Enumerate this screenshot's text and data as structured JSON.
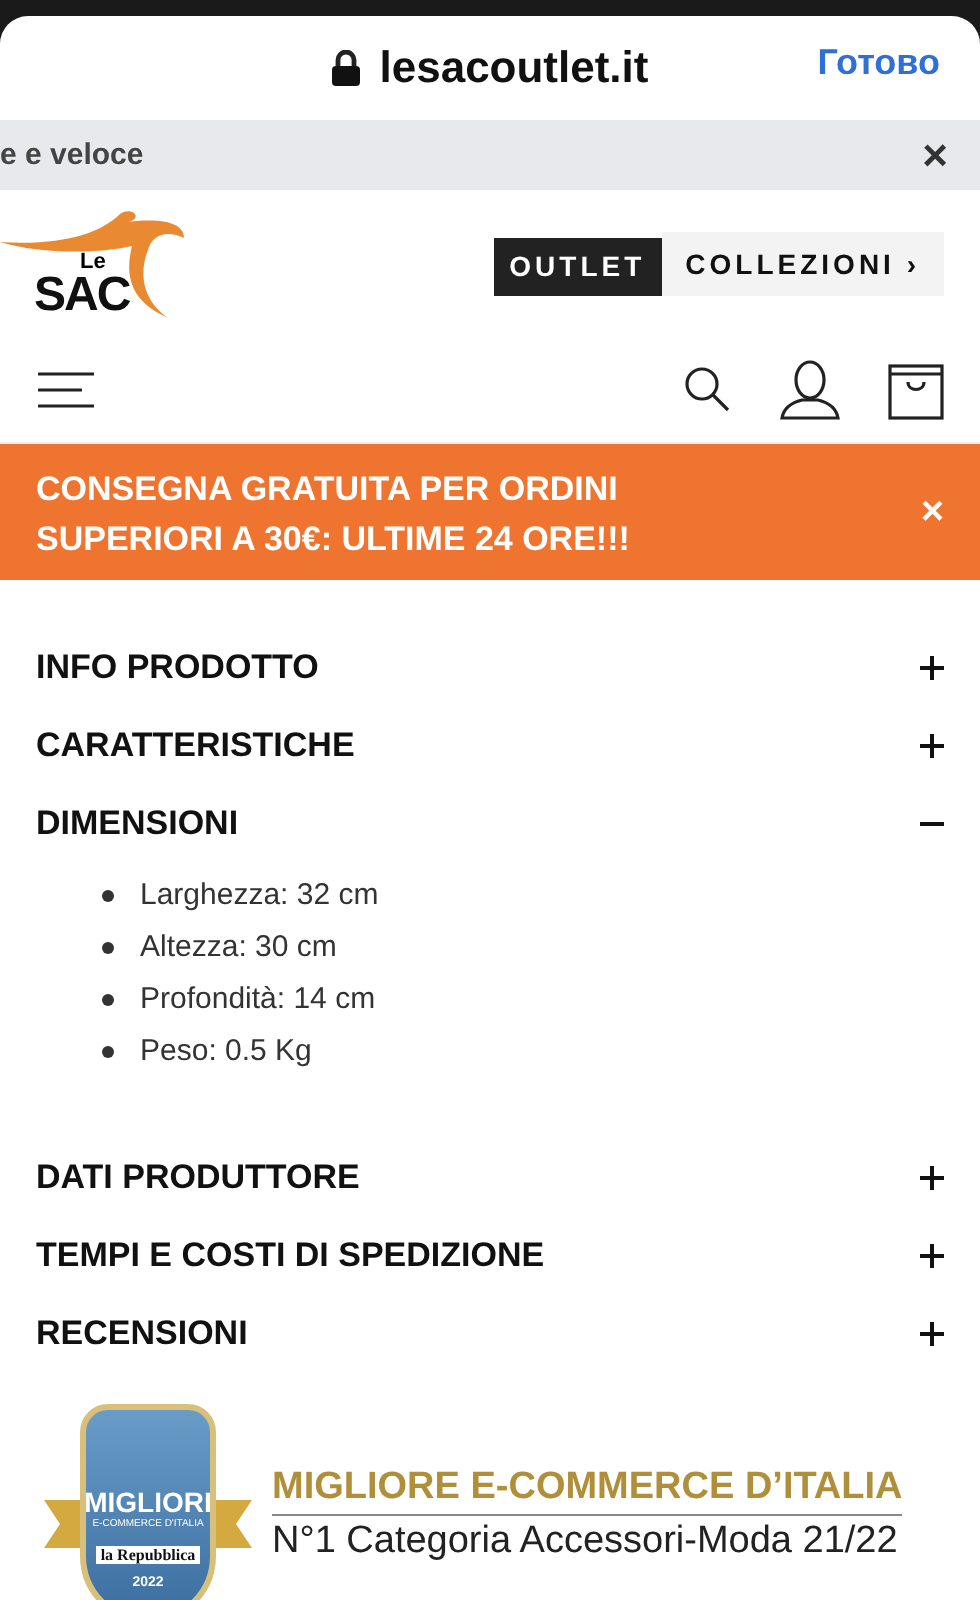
{
  "browser": {
    "domain": "lesacoutlet.it",
    "done": "Готово"
  },
  "notice": {
    "text": "e e veloce",
    "close": "×"
  },
  "logo": {
    "small": "Le",
    "big": "SAC"
  },
  "nav": {
    "outlet": "OUTLET",
    "collections": "COLLEZIONI ›"
  },
  "promo": {
    "text": "CONSEGNA GRATUITA PER ORDINI SUPERIORI A 30€: ULTIME 24 ORE!!!",
    "close": "×"
  },
  "sections": [
    {
      "title": "INFO PRODOTTO",
      "expanded": false
    },
    {
      "title": "CARATTERISTICHE",
      "expanded": false
    },
    {
      "title": "DIMENSIONI",
      "expanded": true,
      "items": [
        "Larghezza: 32 cm",
        "Altezza: 30 cm",
        "Profondità: 14 cm",
        "Peso: 0.5 Kg"
      ]
    },
    {
      "title": "DATI PRODUTTORE",
      "expanded": false
    },
    {
      "title": "TEMPI E COSTI DI SPEDIZIONE",
      "expanded": false
    },
    {
      "title": "RECENSIONI",
      "expanded": false
    }
  ],
  "award": {
    "badge_title": "MIGLIORI",
    "badge_sub": "E-COMMERCE D'ITALIA",
    "badge_paper": "la Repubblica",
    "badge_year": "2022",
    "headline": "MIGLIORE E-COMMERCE D’ITALIA",
    "subline": "N°1 Categoria Accessori-Moda 21/22"
  }
}
